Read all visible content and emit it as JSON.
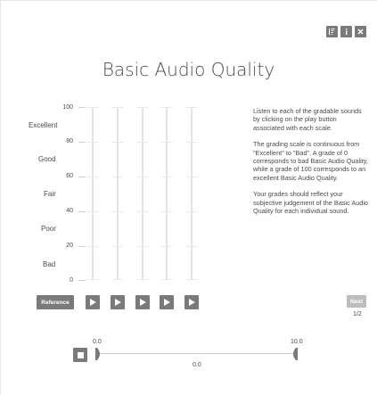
{
  "header": {
    "icons": [
      "sort-icon",
      "info-icon",
      "close-icon"
    ]
  },
  "title": "Basic Audio Quality",
  "scale": {
    "quality_labels": [
      "Excellent",
      "Good",
      "Fair",
      "Poor",
      "Bad"
    ],
    "tick_values": [
      "100",
      "80",
      "60",
      "40",
      "20",
      "0"
    ]
  },
  "sliders_count": 5,
  "instructions": {
    "p1": "Listen to each of the gradable sounds by clicking on the play button associated with each scale.",
    "p2": "The grading scale is continuous from \"Excellent\" to \"Bad\". A grade of 0 corresponds to bad Basic Audio Quality, while a grade of 100 corresponds to an excellent Basic Audio Quality.",
    "p3": "Your grades should reflect your subjective judgement of the Basic Audio Quality for each individual sound."
  },
  "buttons": {
    "reference": "Reference",
    "next": "Next"
  },
  "pagination": "1/2",
  "playback": {
    "start_time": "0.0",
    "end_time": "10.0",
    "current_time": "0.0"
  },
  "colors": {
    "button_bg": "#7a7a7a",
    "button_disabled_bg": "#bdbdbd",
    "rail": "#e3e3e3"
  }
}
